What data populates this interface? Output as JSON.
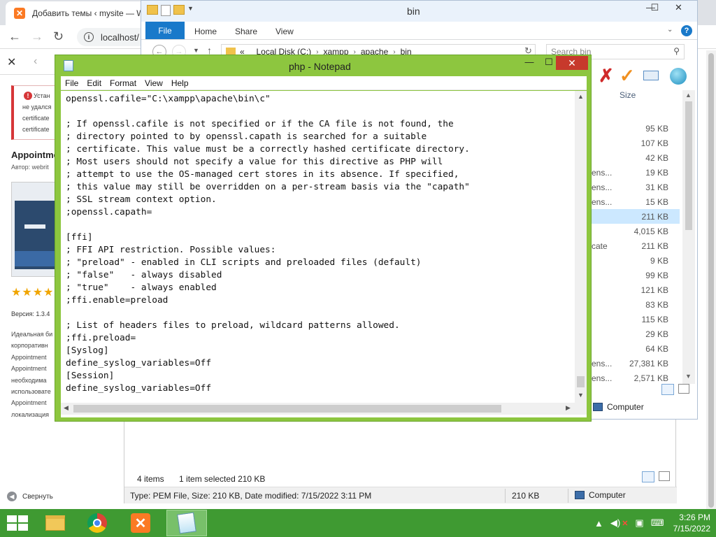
{
  "browser": {
    "tab_title": "Добавить темы ‹ mysite — W",
    "address": "localhost/",
    "page": {
      "warning_lines": [
        "Устан",
        "не удался",
        "certificate",
        "certificate"
      ],
      "plugin_title": "Appointme",
      "plugin_author": "Автор: webrit",
      "rating_stars": "★★★★★",
      "version": "Версия: 1.3.4",
      "description_lines": [
        "Идеальная би",
        "корпоративн",
        "Appointment",
        "Appointment",
        "необходима",
        "использовате",
        "Appointment",
        "локализация"
      ],
      "collapse_menu": "Свернуть"
    }
  },
  "explorer": {
    "title": "bin",
    "ribbon_tabs": {
      "file": "File",
      "home": "Home",
      "share": "Share",
      "view": "View"
    },
    "address_parts": [
      "«",
      "Local Disk (C:)",
      "xampp",
      "apache",
      "bin"
    ],
    "search_placeholder": "Search bin",
    "size_header": "Size",
    "rows": [
      {
        "name": "",
        "size": "95 KB"
      },
      {
        "name": "",
        "size": "107 KB"
      },
      {
        "name": "",
        "size": "42 KB"
      },
      {
        "name": "ens...",
        "size": "19 KB"
      },
      {
        "name": "ens...",
        "size": "31 KB"
      },
      {
        "name": "ens...",
        "size": "15 KB"
      },
      {
        "name": "",
        "size": "211 KB",
        "selected": true
      },
      {
        "name": "",
        "size": "4,015 KB"
      },
      {
        "name": "cate",
        "size": "211 KB"
      },
      {
        "name": "",
        "size": "9 KB"
      },
      {
        "name": "",
        "size": "99 KB"
      },
      {
        "name": "",
        "size": "121 KB"
      },
      {
        "name": "",
        "size": "83 KB"
      },
      {
        "name": "",
        "size": "115 KB"
      },
      {
        "name": "",
        "size": "29 KB"
      },
      {
        "name": "",
        "size": "64 KB"
      },
      {
        "name": "ens...",
        "size": "27,381 KB"
      },
      {
        "name": "ens...",
        "size": "2,571 KB"
      }
    ],
    "computer_label": "Computer"
  },
  "explorer2": {
    "items_count": "4 items",
    "selection": "1 item selected  210 KB",
    "details": "Type: PEM File, Size: 210 KB, Date modified: 7/15/2022 3:11 PM",
    "size": "210 KB",
    "computer_label": "Computer"
  },
  "notepad": {
    "title": "php - Notepad",
    "menu": {
      "file": "File",
      "edit": "Edit",
      "format": "Format",
      "view": "View",
      "help": "Help"
    },
    "lines": [
      "openssl.cafile=\"C:\\xampp\\apache\\bin\\c\"",
      "",
      "; If openssl.cafile is not specified or if the CA file is not found, the",
      "; directory pointed to by openssl.capath is searched for a suitable",
      "; certificate. This value must be a correctly hashed certificate directory.",
      "; Most users should not specify a value for this directive as PHP will",
      "; attempt to use the OS-managed cert stores in its absence. If specified,",
      "; this value may still be overridden on a per-stream basis via the \"capath\"",
      "; SSL stream context option.",
      ";openssl.capath=",
      "",
      "[ffi]",
      "; FFI API restriction. Possible values:",
      "; \"preload\" - enabled in CLI scripts and preloaded files (default)",
      "; \"false\"   - always disabled",
      "; \"true\"    - always enabled",
      ";ffi.enable=preload",
      "",
      "; List of headers files to preload, wildcard patterns allowed.",
      ";ffi.preload=",
      "[Syslog]",
      "define_syslog_variables=Off",
      "[Session]",
      "define_syslog_variables=Off"
    ]
  },
  "taskbar": {
    "time": "3:26 PM",
    "date": "7/15/2022"
  }
}
